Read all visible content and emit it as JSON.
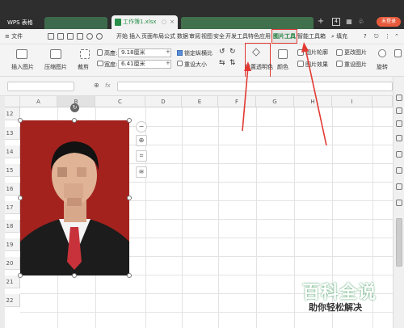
{
  "tabs": {
    "app_tab": "WPS 表格",
    "file_tab": "工作簿1.xlsx",
    "file_mod": "○",
    "close": "×",
    "add": "+",
    "badge": "4",
    "user_button": "未登录"
  },
  "menu": {
    "file": "≡ 文件",
    "items": [
      "开始",
      "插入",
      "页面布局",
      "公式",
      "数据",
      "审阅",
      "视图",
      "安全",
      "开发工具",
      "特色应用"
    ],
    "active": "图片工具",
    "after": "智能工具箱",
    "search": "填充",
    "help": "?"
  },
  "ribbon": {
    "insert_picture": "插入图片",
    "compress_picture": "压缩图片",
    "crop": "裁剪",
    "height_label": "高度:",
    "height_value": "9.18厘米",
    "width_label": "宽度:",
    "width_value": "6.41厘米",
    "lock_ratio": "锁定纵横比",
    "reset_size": "重设大小",
    "set_transparent": "设置透明色",
    "color": "颜色",
    "picture_outline": "图片轮廓",
    "picture_effect": "图片效果",
    "change_picture": "更改图片",
    "reset_picture": "重设图片",
    "rotate": "旋转"
  },
  "formula": {
    "fx": "fx"
  },
  "grid": {
    "columns": [
      "A",
      "B",
      "C",
      "D",
      "E",
      "F",
      "G",
      "H",
      "I"
    ],
    "rows": [
      "12",
      "13",
      "14",
      "15",
      "16",
      "17",
      "18",
      "19",
      "20",
      "21",
      "22"
    ]
  },
  "watermark": {
    "title": "百科全说",
    "subtitle": "助你轻松解决"
  },
  "colors": {
    "accent_red": "#e23a33",
    "tab_green": "#2a8f4a",
    "photo_bg": "#a3221e"
  }
}
